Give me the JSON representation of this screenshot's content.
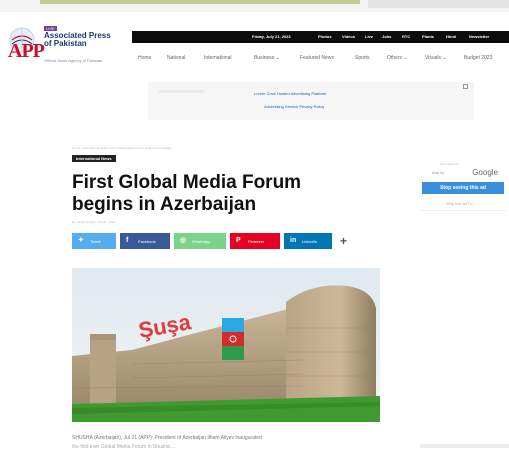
{
  "site": {
    "badge": "LIVE",
    "name_line1": "Associated Press",
    "name_line2": "of Pakistan",
    "logo_letters": "APP",
    "tagline": "Official News Agency of Pakistan"
  },
  "topbar": {
    "date": "Friday, July 21, 2023",
    "links": [
      "Photos",
      "Videos",
      "Live",
      "Jobs",
      "RTC",
      "Plants",
      "Hindi",
      "Newsletter"
    ]
  },
  "nav": {
    "items": [
      "Home",
      "National",
      "International",
      "Business ⌄",
      "Featured News",
      "Sports",
      "Others ⌄",
      "Visuals ⌄",
      "Budget 2023"
    ]
  },
  "ad": {
    "line1": "Lorem Cove Hosted Advertising Platform",
    "line2": "Advertising Service Privacy Policy"
  },
  "breadcrumb": "Home  ›  International News  ›  First Global Media Forum begins in Azerbaijan",
  "article": {
    "category": "International News",
    "title": "First Global Media Forum begins in Azerbaijan",
    "byline": "By Junaid Anwar  •  July 21, 2023",
    "photo_text": "Şuşa",
    "body_line1": "SHUSHA (Azerbaijan), Jul 21 (APP): President of Azerbaijan Ilham Aliyev inaugurated",
    "body_line2": "the first ever Global Media Forum in Shusha...."
  },
  "share": {
    "twitter": "Tweet",
    "facebook": "Facebook",
    "whatsapp": "WhatsApp",
    "pinterest": "Pinterest",
    "linkedin": "LinkedIn",
    "more": "+"
  },
  "sidebar": {
    "label": "Advertisement",
    "ads_by": "Ads by",
    "google": "Google",
    "stop_button": "Stop seeing this ad",
    "why": "Why this ad? ▷"
  },
  "colors": {
    "twitter": "#55acee",
    "facebook": "#3b5998",
    "whatsapp": "#7bd38a",
    "pinterest": "#e60023",
    "linkedin": "#0077b5",
    "ad_button": "#3b8fe0",
    "logo_red": "#c8102e",
    "logo_blue": "#1a3a73"
  }
}
